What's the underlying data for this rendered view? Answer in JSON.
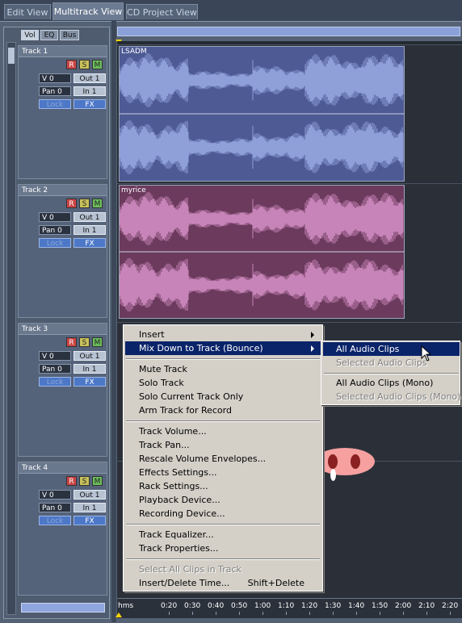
{
  "tabs": [
    "Edit View",
    "Multitrack View",
    "CD Project View"
  ],
  "mini_tabs": [
    "Vol",
    "EQ",
    "Bus"
  ],
  "tracks": [
    {
      "name": "Track 1",
      "vol": "V 0",
      "pan": "Pan 0",
      "out": "Out 1",
      "in": "In 1",
      "lock": "Lock",
      "fx": "FX",
      "r": "R",
      "s": "S",
      "m": "M"
    },
    {
      "name": "Track 2",
      "vol": "V 0",
      "pan": "Pan 0",
      "out": "Out 1",
      "in": "In 1",
      "lock": "Lock",
      "fx": "FX",
      "r": "R",
      "s": "S",
      "m": "M"
    },
    {
      "name": "Track 3",
      "vol": "V 0",
      "pan": "Pan 0",
      "out": "Out 1",
      "in": "In 1",
      "lock": "Lock",
      "fx": "FX",
      "r": "R",
      "s": "S",
      "m": "M"
    },
    {
      "name": "Track 4",
      "vol": "V 0",
      "pan": "Pan 0",
      "out": "Out 1",
      "in": "In 1",
      "lock": "Lock",
      "fx": "FX",
      "r": "R",
      "s": "S",
      "m": "M"
    }
  ],
  "clips": [
    {
      "name": "LSADM",
      "color": "#4d5a94",
      "wave": "#8f9fd8"
    },
    {
      "name": "myrice",
      "color": "#6b3a5d",
      "wave": "#c784b8"
    }
  ],
  "context_menu": {
    "items": [
      "Insert",
      "Mix Down to Track (Bounce)",
      "Mute Track",
      "Solo Track",
      "Solo Current Track Only",
      "Arm Track for Record",
      "Track Volume...",
      "Track Pan...",
      "Rescale Volume Envelopes...",
      "Effects Settings...",
      "Rack Settings...",
      "Playback Device...",
      "Recording Device...",
      "Track Equalizer...",
      "Track Properties...",
      "Select All Clips in Track",
      "Insert/Delete Time..."
    ],
    "shortcut": "Shift+Delete"
  },
  "submenu": {
    "items": [
      "All Audio Clips",
      "Selected Audio Clips",
      "All Audio Clips (Mono)",
      "Selected Audio Clips (Mono)"
    ]
  },
  "ruler": {
    "unit": "hms",
    "labels": [
      "0:20",
      "0:30",
      "0:40",
      "0:50",
      "1:00",
      "1:10",
      "1:20",
      "1:30",
      "1:40",
      "1:50",
      "2:00",
      "2:10",
      "2:20"
    ]
  },
  "colors": {
    "selection": "#0a246a",
    "menu_bg": "#d4d0c8",
    "cursor_marker": "#ffd400"
  },
  "icons": [
    "submenu-arrow-icon",
    "mouse-pointer-icon",
    "pig-nose-icon"
  ]
}
